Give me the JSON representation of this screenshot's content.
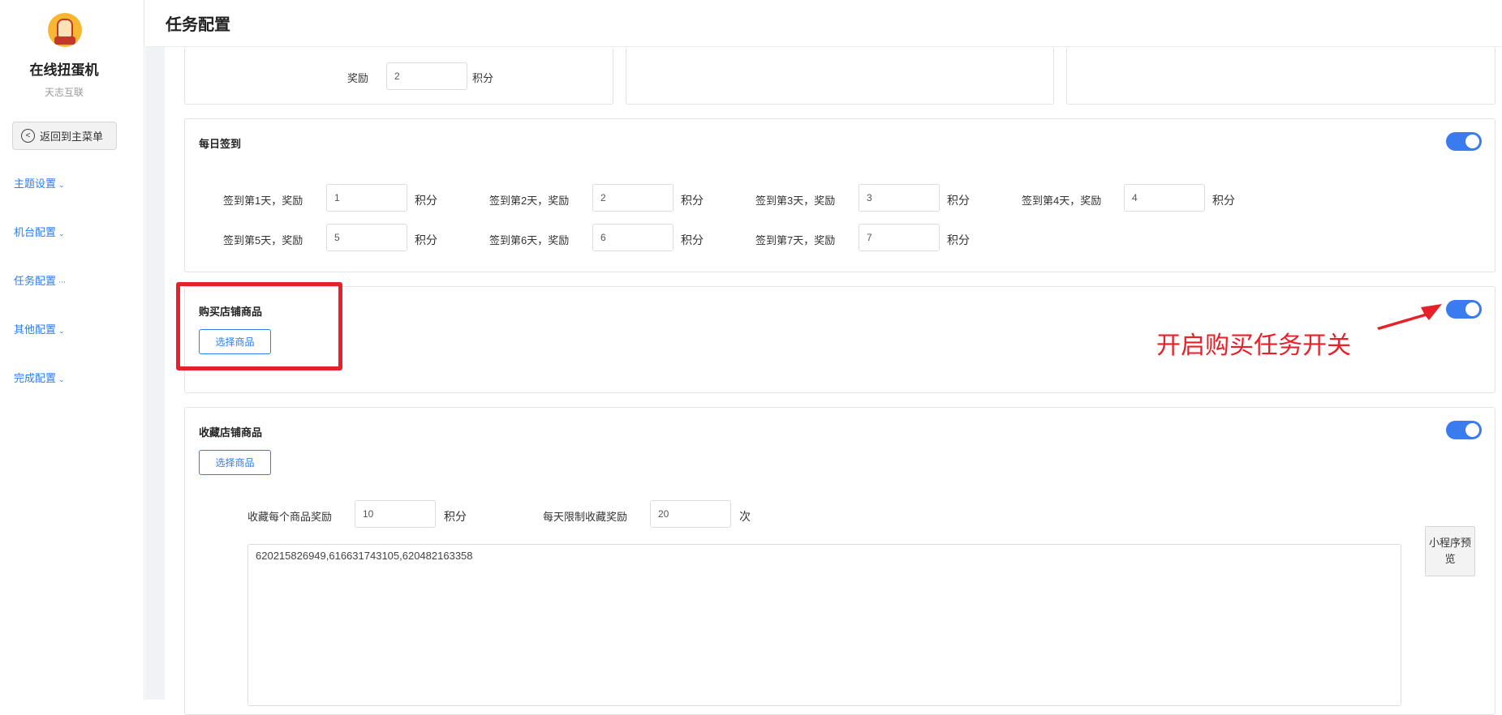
{
  "sidebar": {
    "app_name": "在线扭蛋机",
    "app_sub": "天志互联",
    "back_label": "返回到主菜单",
    "items": [
      {
        "label": "主题设置",
        "suffix": "⌄"
      },
      {
        "label": "机台配置",
        "suffix": "⌄"
      },
      {
        "label": "任务配置",
        "suffix": "⋯"
      },
      {
        "label": "其他配置",
        "suffix": "⌄"
      },
      {
        "label": "完成配置",
        "suffix": "⌄"
      }
    ]
  },
  "header": {
    "title": "任务配置"
  },
  "top_card": {
    "reward_label": "奖励",
    "reward_value": "2",
    "unit": "积分"
  },
  "daily_signin": {
    "title": "每日签到",
    "enabled": true,
    "unit": "积分",
    "days": [
      {
        "label": "签到第1天，奖励",
        "value": "1"
      },
      {
        "label": "签到第2天，奖励",
        "value": "2"
      },
      {
        "label": "签到第3天，奖励",
        "value": "3"
      },
      {
        "label": "签到第4天，奖励",
        "value": "4"
      },
      {
        "label": "签到第5天，奖励",
        "value": "5"
      },
      {
        "label": "签到第6天，奖励",
        "value": "6"
      },
      {
        "label": "签到第7天，奖励",
        "value": "7"
      }
    ]
  },
  "buy_goods": {
    "title": "购买店铺商品",
    "button": "选择商品",
    "enabled": true,
    "annotation": "开启购买任务开关"
  },
  "collect_goods": {
    "title": "收藏店铺商品",
    "button": "选择商品",
    "enabled": true,
    "reward_label": "收藏每个商品奖励",
    "reward_value": "10",
    "reward_unit": "积分",
    "limit_label": "每天限制收藏奖励",
    "limit_value": "20",
    "limit_unit": "次",
    "ids_text": "620215826949,616631743105,620482163358",
    "preview_label": "小程序预览"
  },
  "colors": {
    "accent": "#3a7cf0",
    "annotation": "#e8202a"
  },
  "icons": {
    "back": "back-circle-icon",
    "arrow": "red-arrow-icon"
  }
}
